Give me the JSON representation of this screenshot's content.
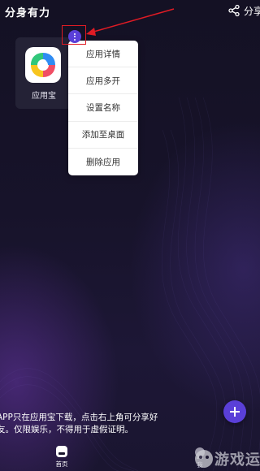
{
  "header": {
    "title": "分身有力",
    "share_label": "分享",
    "share_icon": "share-icon"
  },
  "apps": [
    {
      "label": "应用宝",
      "icon": "yingyongbao-app-icon"
    }
  ],
  "context_menu": {
    "items": [
      "应用详情",
      "应用多开",
      "设置名称",
      "添加至桌面",
      "删除应用"
    ]
  },
  "notice": {
    "line1": "APP只在应用宝下载，点击右上角可分享好",
    "line2": "友。仅限娱乐，不得用于虚假证明。"
  },
  "fab": {
    "icon": "plus-icon"
  },
  "bottom_nav": {
    "items": [
      {
        "label": "首页",
        "icon": "home-icon",
        "active": true
      },
      {
        "label": "我",
        "icon": "user-icon",
        "active": false
      }
    ]
  },
  "watermark": {
    "text": "游戏运子"
  },
  "colors": {
    "accent": "#5a3fd8",
    "annotation": "#e01b24",
    "background": "#17132a",
    "menu_bg": "#ffffff"
  }
}
